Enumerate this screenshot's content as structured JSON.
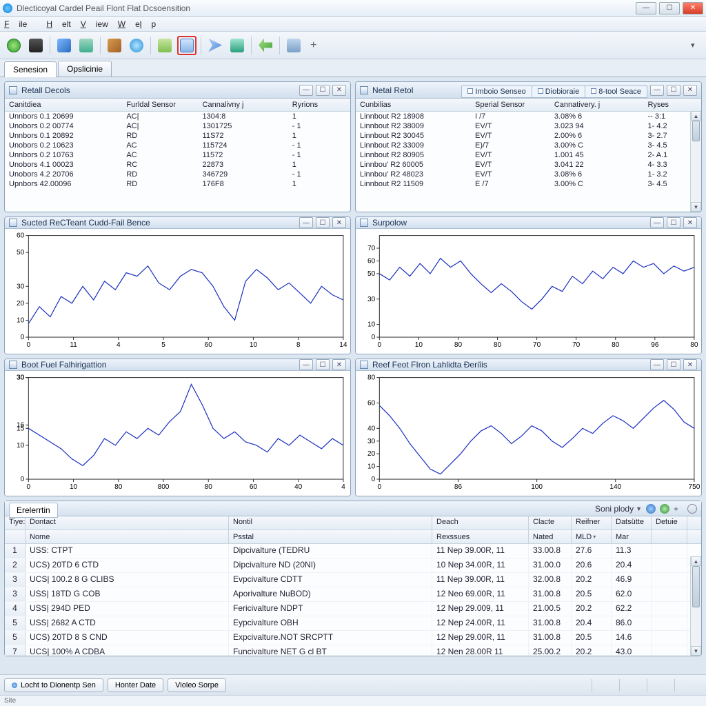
{
  "window": {
    "title": "Dlecticoyal Cardel Peail Flont Flat Dcsoensition"
  },
  "menu": {
    "file": "File",
    "helt": "Helt",
    "view": "View",
    "welp": "Welp"
  },
  "tabs": {
    "session": "Senesion",
    "options": "Opslicinie"
  },
  "panel_left_table": {
    "title": "Retall Decols",
    "cols": [
      "Canitdiea",
      "Furldal Sensor",
      "Cannalivny j",
      "Ryrions"
    ],
    "rows": [
      [
        "Unnbors 0.1 20699",
        "AC|",
        "1304:8",
        "1"
      ],
      [
        "Unobors 0.2 00774",
        "AC|",
        "1301725",
        "- 1"
      ],
      [
        "Unnbors 0.1 20892",
        "RD",
        "11S72",
        "1"
      ],
      [
        "Unobors 0.2 10623",
        "AC",
        "115724",
        "- 1"
      ],
      [
        "Unnbors 0.2 10763",
        "AC",
        "11572",
        "- 1"
      ],
      [
        "Unobors 4.1 00023",
        "RC",
        "22873",
        "1"
      ],
      [
        "Unobors 4.2 20706",
        "RD",
        "346729",
        "- 1"
      ],
      [
        "Upnbors 42.00096",
        "RD",
        "176F8",
        "1"
      ]
    ]
  },
  "panel_right_table": {
    "title": "Netal Retol",
    "subtabs": [
      "Imboio Senseo",
      "Diobioraie",
      "8-tool Seace"
    ],
    "cols": [
      "Cunbilias",
      "Sperial Sensor",
      "Cannativery. j",
      "Ryses"
    ],
    "rows": [
      [
        "Linnbout R2 18908",
        "I /7",
        "3.08% 6",
        "-- 3:1"
      ],
      [
        "Linnbout R2 38009",
        "EV/T",
        "3.023 94",
        "1- 4.2"
      ],
      [
        "Linnbout R2 30045",
        "EV/T",
        "2.00% 6",
        "3- 2.7"
      ],
      [
        "Linnbout R2 33009",
        "E)/7",
        "3.00% C",
        "3- 4.5"
      ],
      [
        "Linnbout R2 80905",
        "EV/T",
        "1.001 45",
        "2- A.1"
      ],
      [
        "Linnbou' R2 60005",
        "EV/T",
        "3.041 22",
        "4- 3.3"
      ],
      [
        "Linnbou' R2 48023",
        "EV/T",
        "3.08% 6",
        "1- 3.2"
      ],
      [
        "Linnbout R2 11509",
        "E /7",
        "3.00% C",
        "3- 4.5"
      ]
    ]
  },
  "chart1": {
    "title": "Sucted ReCTeant Cudd-Fail Bence"
  },
  "chart2": {
    "title": "Surpolow"
  },
  "chart3": {
    "title": "Boot Fuel Falhirigattion"
  },
  "chart4": {
    "title": "Reef Feot FIron Lahlidta Ðeriîis"
  },
  "bottom": {
    "tab": "Erelerrtin",
    "sort_lbl": "Soni plody",
    "h1": [
      "Tiye:",
      "Dontact",
      "Nontil",
      "Deach",
      "Clacte",
      "Reifner",
      "Datsütte",
      "Detuie"
    ],
    "h2": [
      "",
      "Nome",
      "Psstal",
      "Rexssues",
      "Nated",
      "MLD",
      "Mar",
      ""
    ],
    "rows": [
      [
        "1",
        "USS: CTPT",
        "Dipcivalture (TEDRU",
        "11 Nep 39.00R, 11",
        "33.00.8",
        "27.6",
        "11.3"
      ],
      [
        "2",
        "UCS) 20TD 6 CTD",
        "Dipcivalture ND (20NI)",
        "10 Nep 34.00R, 11",
        "31.00.0",
        "20.6",
        "20.4"
      ],
      [
        "3",
        "UCS| 100.2 8 G CLIBS",
        "Evpcivalture CDTT",
        "11 Nep 39.00R, 11",
        "32.00.8",
        "20.2",
        "46.9"
      ],
      [
        "3",
        "USS| 18TD G COB",
        "Aporivalture NuBOD)",
        "12 Neo 69.00R, 11",
        "31.00.8",
        "20.5",
        "62.0"
      ],
      [
        "4",
        "USS| 294D PED",
        "Fericivalture NDPT",
        "12 Nep 29.009, 11",
        "21.00.5",
        "20.2",
        "62.2"
      ],
      [
        "5",
        "USS| 2682 A CTD",
        "Eypcivalture OBH",
        "12 Nep 24.00R, 11",
        "31.00.8",
        "20.4",
        "86.0"
      ],
      [
        "5",
        "UCS) 20TD 8 S CND",
        "Expcivalture.NOT SRCPTT",
        "12 Nep 29.00R, 11",
        "31.00.8",
        "20.5",
        "14.6"
      ],
      [
        "7",
        "UCS| 100% A CDBA",
        "Funcivalture NET G cl BT",
        "12 Nen 28.00R 11",
        "25.00.2",
        "20.2",
        "43.0"
      ]
    ]
  },
  "status": {
    "b1": "Locht to Dionentp Sen",
    "b2": "Honter Date",
    "b3": "Violeo Sorpe"
  },
  "footer": {
    "lbl": "Site"
  },
  "chart_data": [
    {
      "type": "line",
      "title": "Sucted ReCTeant Cudd-Fail Bence",
      "xticks": [
        "0",
        "11",
        "4",
        "5",
        "60",
        "10",
        "8",
        "14"
      ],
      "yticks": [
        0,
        10,
        20,
        30,
        50,
        60
      ],
      "ylim": [
        0,
        60
      ],
      "x": [
        0,
        1,
        2,
        3,
        4,
        5,
        6,
        7,
        8,
        9,
        10,
        11,
        12,
        13,
        14,
        15,
        16,
        17,
        18,
        19,
        20,
        21,
        22,
        23,
        24,
        25,
        26,
        27,
        28,
        29
      ],
      "values": [
        8,
        18,
        12,
        24,
        20,
        30,
        22,
        33,
        28,
        38,
        36,
        42,
        32,
        28,
        36,
        40,
        38,
        30,
        18,
        10,
        33,
        40,
        35,
        28,
        32,
        26,
        20,
        30,
        25,
        22
      ]
    },
    {
      "type": "line",
      "title": "Surpolow",
      "xticks": [
        "0",
        "10",
        "80",
        "80",
        "70",
        "70",
        "80",
        "96",
        "80"
      ],
      "yticks": [
        0,
        10,
        30,
        50,
        60,
        70
      ],
      "ylim": [
        0,
        80
      ],
      "x": [
        0,
        1,
        2,
        3,
        4,
        5,
        6,
        7,
        8,
        9,
        10,
        11,
        12,
        13,
        14,
        15,
        16,
        17,
        18,
        19,
        20,
        21,
        22,
        23,
        24,
        25,
        26,
        27,
        28,
        29,
        30,
        31
      ],
      "values": [
        50,
        45,
        55,
        48,
        58,
        50,
        62,
        55,
        60,
        50,
        42,
        35,
        42,
        36,
        28,
        22,
        30,
        40,
        36,
        48,
        42,
        52,
        46,
        55,
        50,
        60,
        55,
        58,
        50,
        56,
        52,
        55
      ]
    },
    {
      "type": "line",
      "title": "Boot Fuel Falhirigattion",
      "xticks": [
        "0",
        "10",
        "80",
        "800",
        "80",
        "60",
        "40",
        "4"
      ],
      "yticks": [
        0,
        10,
        30,
        15,
        16,
        30,
        30
      ],
      "ylim": [
        0,
        30
      ],
      "x": [
        0,
        1,
        2,
        3,
        4,
        5,
        6,
        7,
        8,
        9,
        10,
        11,
        12,
        13,
        14,
        15,
        16,
        17,
        18,
        19,
        20,
        21,
        22,
        23,
        24,
        25,
        26,
        27,
        28,
        29
      ],
      "values": [
        15,
        13,
        11,
        9,
        6,
        4,
        7,
        12,
        10,
        14,
        12,
        15,
        13,
        17,
        20,
        28,
        22,
        15,
        12,
        14,
        11,
        10,
        8,
        12,
        10,
        13,
        11,
        9,
        12,
        10
      ]
    },
    {
      "type": "line",
      "title": "Reef Feot FIron Lahlidta Ðeriîis",
      "xticks": [
        "0",
        "86",
        "100",
        "140",
        "750"
      ],
      "yticks": [
        0,
        10,
        20,
        30,
        40,
        60,
        80
      ],
      "ylim": [
        0,
        80
      ],
      "x": [
        0,
        1,
        2,
        3,
        4,
        5,
        6,
        7,
        8,
        9,
        10,
        11,
        12,
        13,
        14,
        15,
        16,
        17,
        18,
        19,
        20,
        21,
        22,
        23,
        24,
        25,
        26,
        27,
        28,
        29,
        30,
        31
      ],
      "values": [
        58,
        50,
        40,
        28,
        18,
        8,
        4,
        12,
        20,
        30,
        38,
        42,
        36,
        28,
        34,
        42,
        38,
        30,
        25,
        32,
        40,
        36,
        44,
        50,
        46,
        40,
        48,
        56,
        62,
        55,
        45,
        40
      ]
    }
  ]
}
